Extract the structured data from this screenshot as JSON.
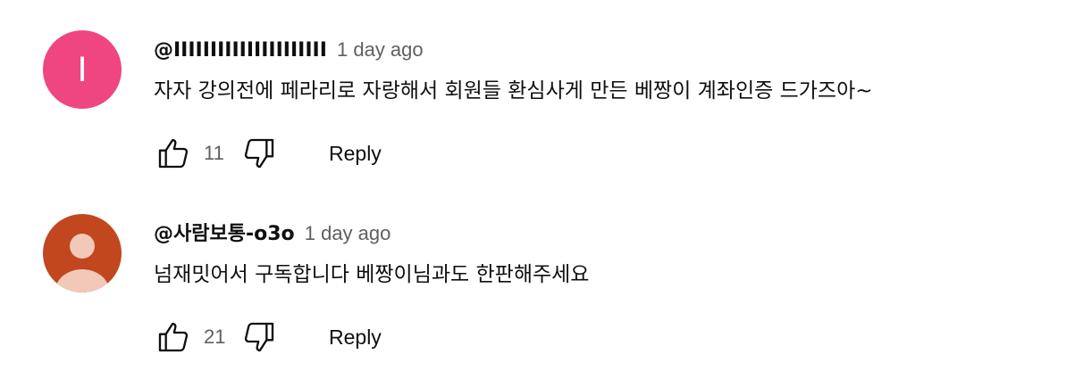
{
  "comments": [
    {
      "author": "@IIIIIIIIIIIIIIIIIIIII",
      "time": "1 day ago",
      "text": "자자 강의전에 페라리로 자랑해서 회원들 환심사게 만든 베짱이 계좌인증 드가즈아~",
      "likes": "11",
      "reply_label": "Reply",
      "avatar": {
        "type": "letter",
        "letter": "I",
        "color": "#ef4581"
      }
    },
    {
      "author": "@사람보통-o3o",
      "time": "1 day ago",
      "text": "넘재밋어서 구독합니다 베짱이님과도 한판해주세요",
      "likes": "21",
      "reply_label": "Reply",
      "avatar": {
        "type": "person-icon",
        "color": "#c2461e",
        "figure_color": "#f2c8b8"
      }
    }
  ],
  "icons": {
    "like": "thumb-up-icon",
    "dislike": "thumb-down-icon"
  }
}
